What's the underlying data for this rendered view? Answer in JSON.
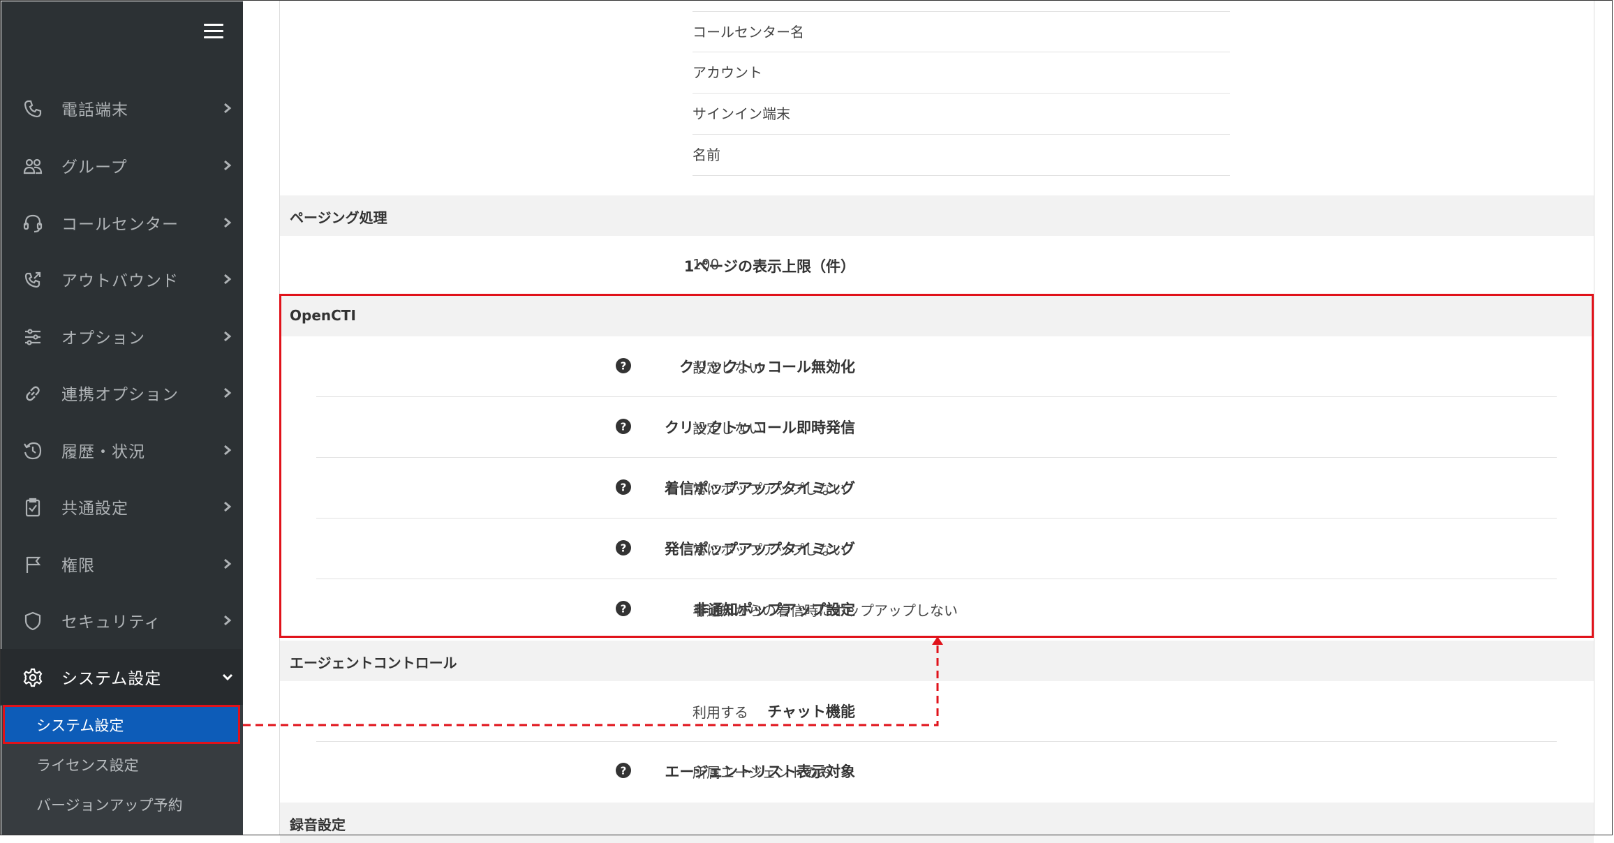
{
  "sidebar": {
    "menu_icon": "hamburger-menu-icon",
    "items": [
      {
        "label": "電話端末",
        "icon": "phone-icon"
      },
      {
        "label": "グループ",
        "icon": "group-icon"
      },
      {
        "label": "コールセンター",
        "icon": "headset-icon"
      },
      {
        "label": "アウトバウンド",
        "icon": "outbound-call-icon"
      },
      {
        "label": "オプション",
        "icon": "sliders-icon"
      },
      {
        "label": "連携オプション",
        "icon": "link-icon"
      },
      {
        "label": "履歴・状況",
        "icon": "history-icon"
      },
      {
        "label": "共通設定",
        "icon": "checklist-icon"
      },
      {
        "label": "権限",
        "icon": "flag-icon"
      },
      {
        "label": "セキュリティ",
        "icon": "shield-icon"
      },
      {
        "label": "システム設定",
        "icon": "gear-icon"
      }
    ],
    "sub_items": [
      {
        "label": "システム設定",
        "active": true
      },
      {
        "label": "ライセンス設定"
      },
      {
        "label": "バージョンアップ予約"
      }
    ]
  },
  "top_list": [
    "コールセンター名",
    "アカウント",
    "サインイン端末",
    "名前"
  ],
  "paging": {
    "title": "ページング処理",
    "rows": [
      {
        "label": "1ページの表示上限（件）",
        "value": "100"
      }
    ]
  },
  "opencti": {
    "title": "OpenCTI",
    "rows": [
      {
        "label": "クリックトゥコール無効化",
        "value": "設定しない"
      },
      {
        "label": "クリックトゥコール即時発信",
        "value": "設定しない"
      },
      {
        "label": "着信ポップアップタイミング",
        "value": "常にポップアップしない"
      },
      {
        "label": "発信ポップアップタイミング",
        "value": "常にポップアップしない"
      },
      {
        "label": "非通知ポップアップ設定",
        "value": "非通知からの着信時にポップアップしない"
      }
    ]
  },
  "agent_control": {
    "title": "エージェントコントロール",
    "rows": [
      {
        "label": "チャット機能",
        "value": "利用する"
      },
      {
        "label": "エージェントリスト表示対象",
        "value": "所属エージェントのみ"
      }
    ]
  },
  "recording": {
    "title": "録音設定"
  },
  "colors": {
    "sidebar_bg": "#2c3134",
    "active_blue": "#0d5cb8",
    "annotation_red": "#e0121a"
  }
}
